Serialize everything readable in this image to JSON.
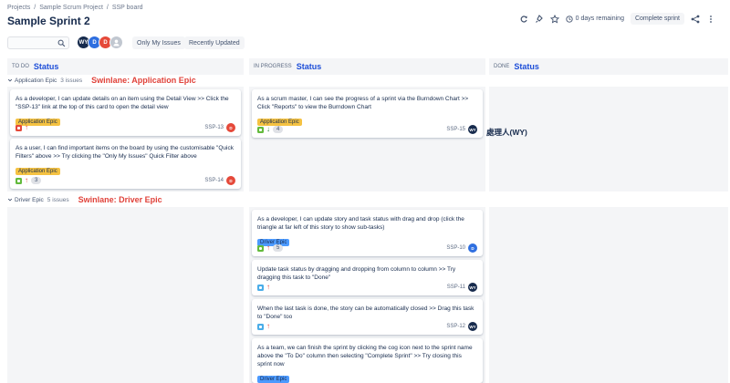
{
  "breadcrumbs": [
    "Projects",
    "Sample Scrum Project",
    "SSP board"
  ],
  "breadcrumb_separator": "/",
  "title": "Sample Sprint 2",
  "topbar": {
    "time_remaining": "0 days remaining",
    "complete_label": "Complete sprint"
  },
  "filters": {
    "only_my_issues": "Only My Issues",
    "recently_updated": "Recently Updated"
  },
  "avatars": [
    {
      "initials": "WY",
      "color": "#172b4d"
    },
    {
      "initials": "D",
      "color": "#2f6fe0"
    },
    {
      "initials": "D",
      "color": "#e5493a"
    },
    {
      "initials": "",
      "color": "#c1c7d0"
    }
  ],
  "columns": [
    {
      "name": "TO DO",
      "annotation": "Status"
    },
    {
      "name": "IN PROGRESS",
      "annotation": "Status"
    },
    {
      "name": "DONE",
      "annotation": "Status"
    }
  ],
  "swimlanes": [
    {
      "name": "Application Epic",
      "count": "3 issues",
      "annotation": "Swinlane: Application Epic"
    },
    {
      "name": "Driver Epic",
      "count": "5 issues",
      "annotation": "Swinlane: Driver Epic"
    }
  ],
  "assignee_annotation": "處理人(WY)",
  "cards": [
    {
      "summary": "As a developer, I can update details on an item using the Detail View >> Click the \"SSP-13\" link at the top of this card to open the detail view",
      "epic": "Application Epic",
      "type": "bug",
      "priority": "up",
      "points": "",
      "key": "SSP-13",
      "assignee": "D",
      "assignee_color": "#e5493a"
    },
    {
      "summary": "As a user, I can find important items on the board by using the customisable \"Quick Filters\" above >> Try clicking the \"Only My Issues\" Quick Filter above",
      "epic": "Application Epic",
      "type": "story",
      "priority": "up",
      "points": "3",
      "key": "SSP-14",
      "assignee": "D",
      "assignee_color": "#e5493a"
    },
    {
      "summary": "As a scrum master, I can see the progress of a sprint via the Burndown Chart >> Click \"Reports\" to view the Burndown Chart",
      "epic": "Application Epic",
      "type": "story",
      "priority": "down",
      "points": "4",
      "key": "SSP-15",
      "assignee": "WY",
      "assignee_color": "#172b4d"
    },
    {
      "summary": "As a developer, I can update story and task status with drag and drop (click the triangle at far left of this story to show sub-tasks)",
      "epic": "Driver Epic",
      "type": "story",
      "priority": "up",
      "points": "5",
      "key": "SSP-10",
      "assignee": "D",
      "assignee_color": "#2f6fe0"
    },
    {
      "summary": "Update task status by dragging and dropping from column to column >> Try dragging this task to \"Done\"",
      "epic": "",
      "type": "task",
      "priority": "up",
      "points": "",
      "key": "SSP-11",
      "assignee": "WY",
      "assignee_color": "#172b4d"
    },
    {
      "summary": "When the last task is done, the story can be automatically closed >> Drag this task to \"Done\" too",
      "epic": "",
      "type": "task",
      "priority": "up",
      "points": "",
      "key": "SSP-12",
      "assignee": "WY",
      "assignee_color": "#172b4d"
    },
    {
      "summary": "As a team, we can finish the sprint by clicking the cog icon next to the sprint name above the \"To Do\" column then selecting \"Complete Sprint\" >> Try closing this sprint now",
      "epic": "Driver Epic",
      "type": "",
      "priority": "",
      "points": "",
      "key": "",
      "assignee": "",
      "assignee_color": ""
    }
  ]
}
